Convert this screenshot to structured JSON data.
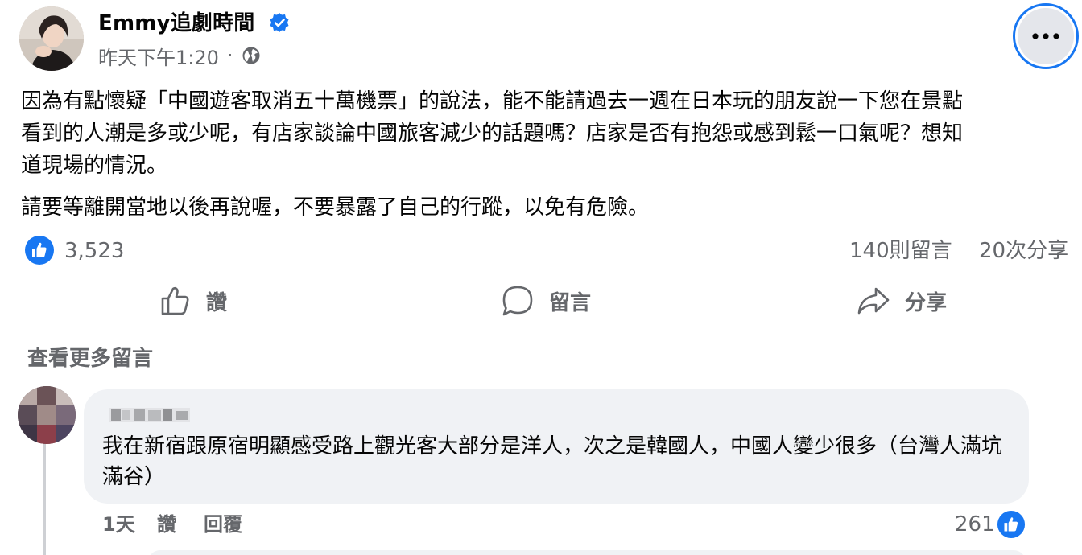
{
  "post": {
    "author_name": "Emmy追劇時間",
    "timestamp": "昨天下午1:20",
    "separator": "·",
    "privacy_icon": "globe-icon",
    "verified_icon": "verified-badge-icon",
    "more_icon": "more-dots-icon",
    "paragraph_1": "因為有點懷疑「中國遊客取消五十萬機票」的說法，能不能請過去一週在日本玩的朋友說一下您在景點看到的人潮是多或少呢，有店家談論中國旅客減少的話題嗎？店家是否有抱怨或感到鬆一口氣呢？想知道現場的情況。",
    "paragraph_1_lines": [
      "因為有點懷疑「中國遊客取消五十萬機票」的說法，能不能請過去一週在日本玩的朋友說一下您在景點",
      "看到的人潮是多或少呢，有店家談論中國旅客減少的話題嗎？店家是否有抱怨或感到鬆一口氣呢？想知",
      "道現場的情況。"
    ],
    "paragraph_2": "請要等離開當地以後再說喔，不要暴露了自己的行蹤，以免有危險。"
  },
  "stats": {
    "like_count": "3,523",
    "comment_count": "140則留言",
    "share_count": "20次分享"
  },
  "actions": {
    "like_label": "讚",
    "comment_label": "留言",
    "share_label": "分享"
  },
  "comments": {
    "view_more_label": "查看更多留言",
    "items": [
      {
        "text": "我在新宿跟原宿明顯感受路上觀光客大部分是洋人，次之是韓國人，中國人變少很多（台灣人滿坑滿谷）",
        "time": "1天",
        "like_label": "讚",
        "reply_label": "回覆",
        "reaction_count": "261"
      }
    ]
  },
  "colors": {
    "accent": "#1877f2",
    "secondary_text": "#65676b",
    "bubble_bg": "#f0f2f5",
    "primary_text": "#050505"
  }
}
